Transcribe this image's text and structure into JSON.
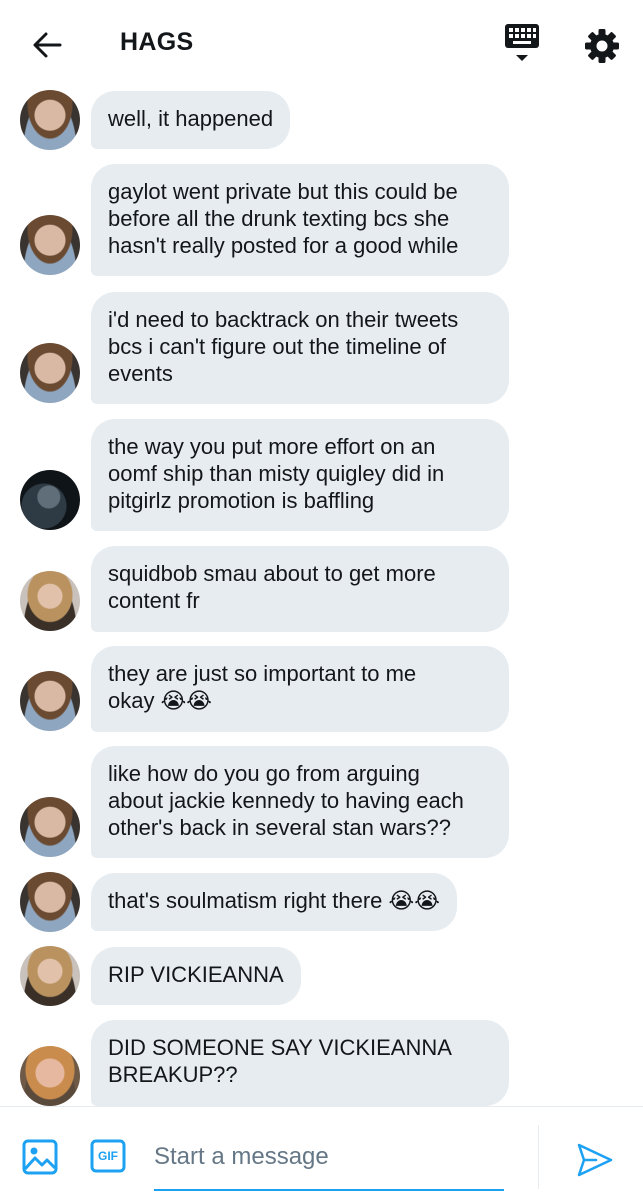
{
  "header": {
    "back_icon": "arrow-left-icon",
    "title": "HAGS",
    "keyboard_icon": "keyboard-icon",
    "settings_icon": "gear-icon"
  },
  "messages": [
    {
      "avatar": "boy",
      "text": "well, it happened"
    },
    {
      "avatar": "boy",
      "text": "gaylot went private but this could be\nbefore all the drunk texting bcs she\nhasn't really posted for a good while"
    },
    {
      "avatar": "boy",
      "text": "i'd need to backtrack on their tweets\nbcs i can't figure out the timeline of\nevents"
    },
    {
      "avatar": "dark",
      "text": "the way you put more effort on an\noomf ship than misty quigley did in\npitgirlz promotion is baffling"
    },
    {
      "avatar": "girl",
      "text": "squidbob smau about to get more\ncontent fr"
    },
    {
      "avatar": "boy",
      "text": "they are just so important to me\nokay 😭😭"
    },
    {
      "avatar": "boy",
      "text": "like how do you go from arguing\nabout jackie kennedy to having each\nother's back in several stan wars??"
    },
    {
      "avatar": "boy",
      "text": "that's soulmatism right there 😭😭"
    },
    {
      "avatar": "girl",
      "text": "RIP VICKIEANNA"
    },
    {
      "avatar": "woman",
      "text": "DID SOMEONE SAY VICKIEANNA\nBREAKUP??"
    }
  ],
  "composer": {
    "image_icon": "image-icon",
    "gif_label": "GIF",
    "placeholder": "Start a message",
    "send_icon": "send-icon"
  },
  "colors": {
    "accent": "#1da1f2",
    "bubble": "#e6ecf0",
    "text": "#14171a",
    "placeholder": "#657786"
  }
}
